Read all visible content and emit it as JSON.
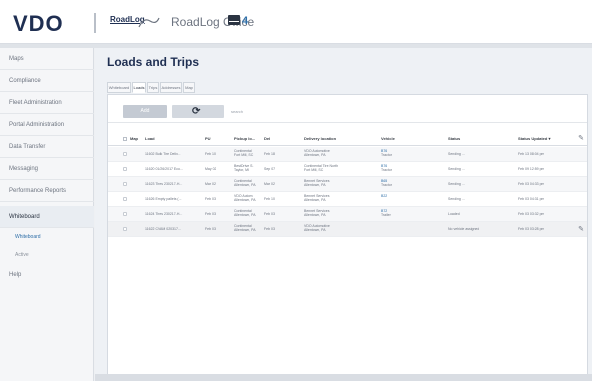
{
  "header": {
    "brand": "VDO",
    "app_logo_text": "RoadLog",
    "app_title": "RoadLog Office",
    "mail_count": "4",
    "mail_icon": "mail-icon"
  },
  "sidebar": {
    "items": [
      {
        "label": "Maps"
      },
      {
        "label": "Compliance"
      },
      {
        "label": "Fleet Administration"
      },
      {
        "label": "Portal Administration"
      },
      {
        "label": "Data Transfer"
      },
      {
        "label": "Messaging"
      },
      {
        "label": "Performance Reports"
      },
      {
        "label": "Whiteboard"
      },
      {
        "label": "Help"
      }
    ],
    "sub_items": [
      {
        "label": "Whiteboard"
      },
      {
        "label": "Active"
      }
    ]
  },
  "main": {
    "title": "Loads and Trips",
    "tabs": [
      {
        "label": "Whiteboard"
      },
      {
        "label": "Loads"
      },
      {
        "label": "Trips"
      },
      {
        "label": "Addresses"
      },
      {
        "label": "Map"
      }
    ],
    "toolbar": {
      "add_label": "Add",
      "refresh_glyph": "⟳",
      "search_placeholder": "search"
    },
    "columns": {
      "map": "Map",
      "load": "Load",
      "pu": "PU",
      "pickup": "Pickup lo...",
      "del": "Del",
      "delivery": "Delivery location",
      "vehicle": "Vehicle",
      "status": "Status",
      "updated": "Status Updated ▾"
    },
    "rows": [
      {
        "load": "11602 Bulk Tire Deliv...",
        "pu": "Feb 10",
        "pickup1": "Continental",
        "pickup2": "Fort Mill, SC",
        "del": "Feb 18",
        "delivery1": "VDO Automotive",
        "delivery2": "Allentown, PA",
        "vehicle1": "B76",
        "vehicle2": "Tractor",
        "status": "Sending ...",
        "updated": "Feb 13 08:04 pm"
      },
      {
        "load": "11620 01/26/2017 Eco...",
        "pu": "May 02",
        "pickup1": "BestDrive S.",
        "pickup2": "Taylor, MI",
        "del": "Sep 07",
        "delivery1": "Continental Tire North",
        "delivery2": "Fort Mill, SC",
        "vehicle1": "B76",
        "vehicle2": "Tractor",
        "status": "Sending ...",
        "updated": "Feb 09 12:59 pm"
      },
      {
        "load": "11623 Tires 230217-H...",
        "pu": "Mar 02",
        "pickup1": "Continental",
        "pickup2": "Allentown, PA",
        "del": "Mar 02",
        "delivery1": "Bennet Services",
        "delivery2": "Allentown, PA",
        "vehicle1": "B65",
        "vehicle2": "Tractor",
        "status": "Sending ...",
        "updated": "Feb 03 04:33 pm"
      },
      {
        "load": "11626 Empty pallets (...",
        "pu": "Feb 03",
        "pickup1": "VDO Autom",
        "pickup2": "Allentown, PA",
        "del": "Feb 10",
        "delivery1": "Bennet Services",
        "delivery2": "Allentown, PA",
        "vehicle1": "B22",
        "vehicle2": "",
        "status": "Sending ...",
        "updated": "Feb 03 04:31 pm"
      },
      {
        "load": "11624 Tires 230217-H...",
        "pu": "Feb 03",
        "pickup1": "Continental",
        "pickup2": "Allentown, PA",
        "del": "Feb 03",
        "delivery1": "Bennet Services",
        "delivery2": "Allentown, PA",
        "vehicle1": "B72",
        "vehicle2": "Trailer",
        "status": "Loaded",
        "updated": "Feb 03 03:32 pm"
      },
      {
        "load": "11622 CVAM 020317...",
        "pu": "Feb 03",
        "pickup1": "Continental",
        "pickup2": "Allentown, PA",
        "del": "Feb 03",
        "delivery1": "VDO Automotive",
        "delivery2": "Allentown, PA",
        "vehicle1": "",
        "vehicle2": "",
        "status": "No vehicle assigned",
        "updated": "Feb 03 03:28 pm"
      }
    ],
    "edit_icon": "pencil-icon"
  },
  "colors": {
    "brand": "#1f2f52",
    "link": "#2f6fa8",
    "background": "#eef1f5"
  }
}
